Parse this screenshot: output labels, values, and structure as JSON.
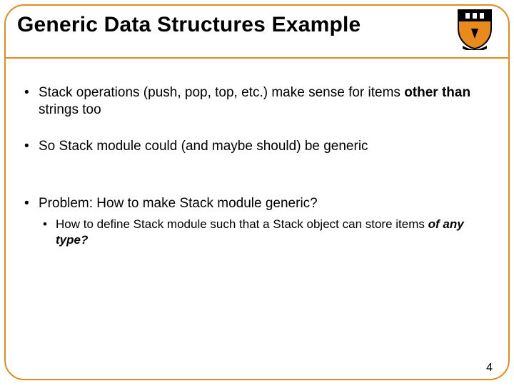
{
  "title": "Generic Data Structures Example",
  "bullets": {
    "a": {
      "pre": "Stack operations (push, pop, top, etc.) make sense for items ",
      "strong": "other than",
      "post": " strings too"
    },
    "b": "So Stack module could (and maybe should) be generic",
    "c": "Problem: How to make Stack module generic?",
    "c_sub": {
      "pre": "How to define Stack module such that a Stack object can store items ",
      "em": "of any type?"
    }
  },
  "page_number": "4",
  "logo": {
    "name": "princeton-shield"
  }
}
